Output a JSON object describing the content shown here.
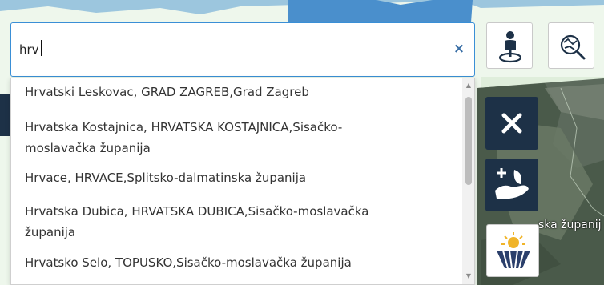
{
  "search": {
    "value": "hrv",
    "clear_glyph": "×"
  },
  "results": [
    {
      "lines": [
        "Hrvatski Leskovac, GRAD ZAGREB,Grad Zagreb"
      ]
    },
    {
      "lines": [
        "Hrvatska Kostajnica, HRVATSKA KOSTAJNICA,Sisačko-",
        "moslavačka županija"
      ]
    },
    {
      "lines": [
        "Hrvace, HRVACE,Splitsko-dalmatinska županija"
      ]
    },
    {
      "lines": [
        "Hrvatska Dubica, HRVATSKA DUBICA,Sisačko-moslavačka",
        "županija"
      ]
    },
    {
      "lines": [
        "Hrvatsko Selo, TOPUSKO,Sisačko-moslavačka županija"
      ]
    }
  ],
  "map": {
    "region_label": "ska županij"
  },
  "tools": {
    "person_location_icon": "person-pin-icon",
    "search_location_icon": "map-search-icon",
    "close_icon": "close-icon",
    "add_plant_icon": "add-plant-hand-icon",
    "fields_icon": "sun-fields-icon"
  },
  "colors": {
    "accent_border": "#3a8fd6",
    "dark_button": "#1d3147",
    "map_water": "#5a9fd4",
    "map_land": "#eef7ec"
  }
}
